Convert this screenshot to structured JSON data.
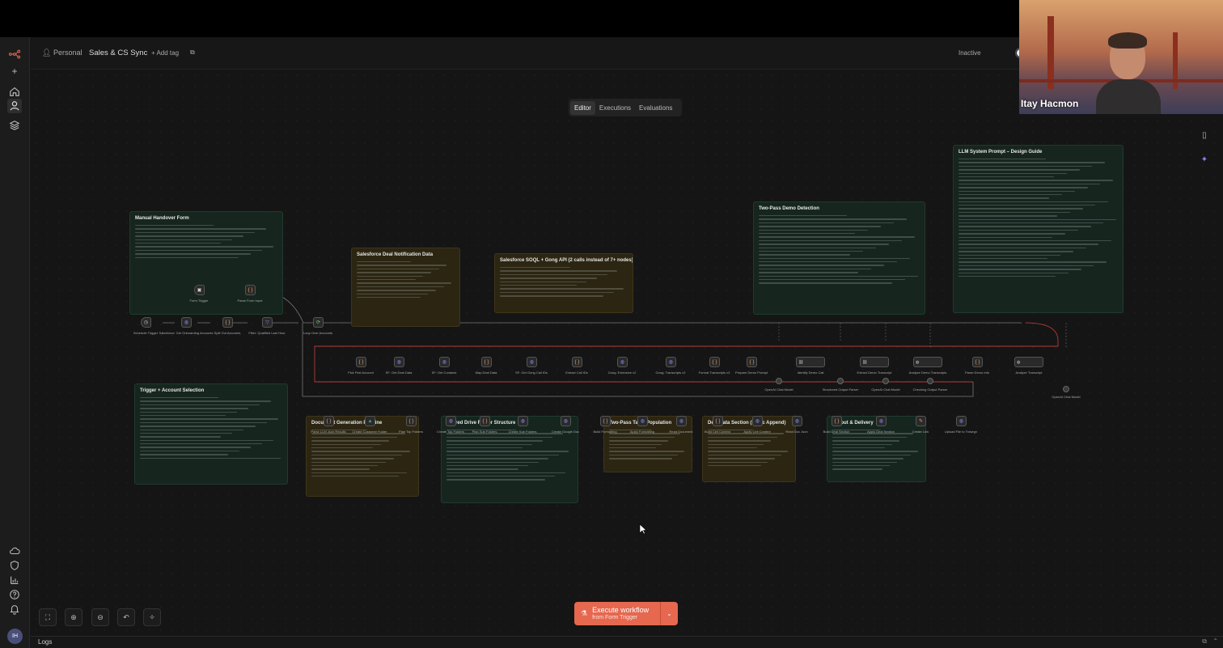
{
  "header": {
    "workspace": "Personal",
    "workflow_name": "Sales & CS Sync",
    "add_tag": "+ Add tag",
    "status_label": "Inactive"
  },
  "tabs": [
    "Editor",
    "Executions",
    "Evaluations"
  ],
  "active_tab": "Editor",
  "webcam": {
    "name": "Itay Hacmon"
  },
  "sticky_notes": [
    {
      "id": "manual-handover",
      "title": "Manual Handover Form",
      "color": "green",
      "lines": 10
    },
    {
      "id": "trigger-account",
      "title": "Trigger + Account Selection",
      "color": "green",
      "lines": 18
    },
    {
      "id": "sf-deal",
      "title": "Salesforce Deal Notification Data",
      "color": "gold",
      "lines": 11
    },
    {
      "id": "sf-soql",
      "title": "Salesforce SOQL + Gong API (2 calls instead of 7+ nodes)",
      "color": "gold",
      "lines": 9
    },
    {
      "id": "two-pass-demo",
      "title": "Two-Pass Demo Detection",
      "color": "green",
      "lines": 20
    },
    {
      "id": "llm-system",
      "title": "LLM System Prompt – Design Guide",
      "color": "green",
      "lines": 34
    },
    {
      "id": "doc-gen",
      "title": "Document Generation Pipeline",
      "color": "gold",
      "lines": 14
    },
    {
      "id": "shared-drive",
      "title": "Shared Drive Folder Structure",
      "color": "green",
      "lines": 15
    },
    {
      "id": "two-pass-table",
      "title": "Two-Pass Table Population",
      "color": "gold",
      "lines": 9
    },
    {
      "id": "deal-data",
      "title": "Deal Data Section (Static Append)",
      "color": "gold",
      "lines": 11
    },
    {
      "id": "output-delivery",
      "title": "Output & Delivery",
      "color": "green",
      "lines": 12
    }
  ],
  "nodes": {
    "form_trigger": "Form Trigger",
    "parse_form": "Parse Form Input",
    "schedule_trigger": "Schedule Trigger",
    "salesforce_active": "Salesforce: Get Onboarding Accounts",
    "split_out": "Split Out Accounts",
    "filter": "Filter: Qualified Last Hour",
    "loop": "Loop Over Accounts",
    "row1": [
      "Pick First Account",
      "SF: Get Deal Data",
      "SF: Get Contacts",
      "Map Deal Data",
      "SF: Get Gong Call IDs",
      "Extract Call IDs",
      "Gong: Extensive v2",
      "Gong: Transcripts v2",
      "Format Transcripts v3",
      "Prepare Demo Prompt",
      "Identify Demo Call",
      "Extract Demo Transcript",
      "Analyze Demo Transcripts",
      "Parse Demo Info",
      "Analyze Transcript"
    ],
    "row1_sub": [
      "OpenAI Chat Model",
      "Structured Output Parser",
      "OpenAI Chat Model",
      "Checking Output Parser",
      "OpenAI Chat Model"
    ],
    "row2": [
      "Parse LLM Json Results",
      "Create Customer Folder",
      "Plan Top Folders",
      "Create Top Folders",
      "Plan Sub Folders",
      "Create Sub Folders",
      "Create Google Doc",
      "Build Formatting",
      "Apply Formatting",
      "Read Document",
      "Build Cell Content",
      "Apply Cell Content",
      "Read Doc Json",
      "Build Deal Section",
      "Apply Deal Section",
      "Create Link",
      "Upload File to Trdwrgn"
    ]
  },
  "controls": {
    "execute_label": "Execute workflow",
    "execute_sub": "from Form Trigger"
  },
  "logs": "Logs",
  "avatar_initials": "IH",
  "icons": {
    "logo": "n8n-logo-icon",
    "webcam_name_color": "#ffffff",
    "execute_color": "#e5684f",
    "accent_purple": "#7f8cf2",
    "accent_orange": "#f0a35e"
  }
}
